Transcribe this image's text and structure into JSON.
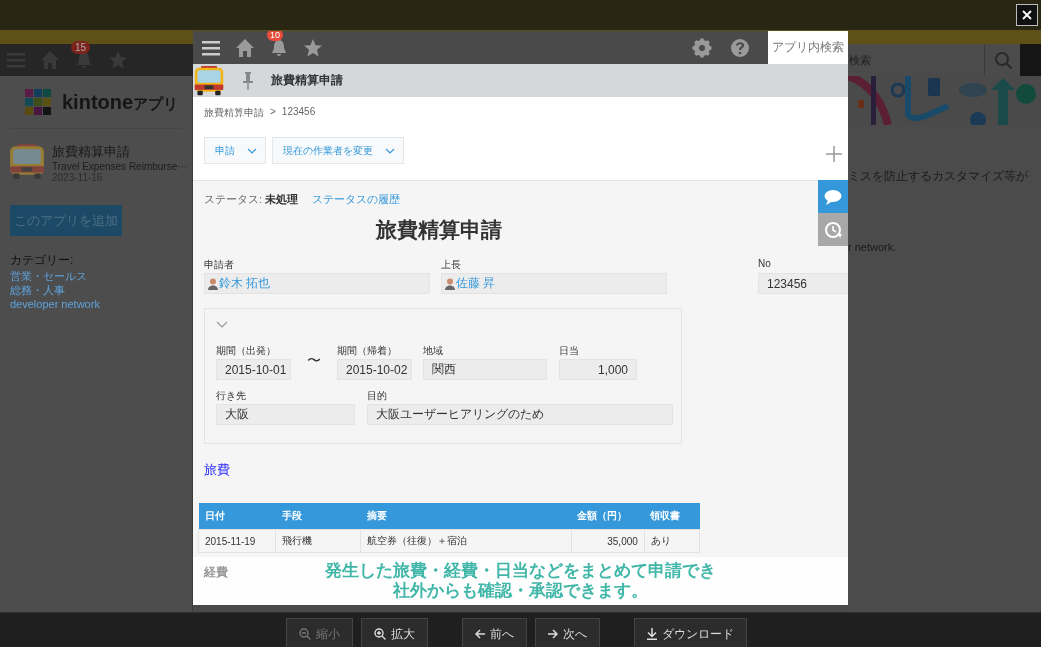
{
  "background_page": {
    "header": {
      "notification_count": "15",
      "search_placeholder": "検索"
    },
    "logo_text": "kintone",
    "logo_suffix": "アプリ",
    "app": {
      "name": "旅費精算申請",
      "subtitle": "Travel Expenses Reimburse···",
      "date": "2023-11-16"
    },
    "add_button": "このアプリを追加",
    "category_label": "カテゴリー:",
    "categories": [
      "営業・セールス",
      "総務・人事",
      "developer network"
    ],
    "description_lines": [
      "ミスを防止するカスタマイズ等が",
      "r network."
    ]
  },
  "record": {
    "header": {
      "notification_count": "10",
      "search_placeholder": "アプリ内検索"
    },
    "app_title": "旅費精算申請",
    "breadcrumb": {
      "app": "旅費精算申請",
      "separator": ">",
      "record": "123456"
    },
    "actions": [
      "申請",
      "現在の作業者を変更"
    ],
    "side_tabs": [
      {
        "kind": "comments",
        "selected": true
      },
      {
        "kind": "history",
        "selected": false
      }
    ],
    "status": {
      "label": "ステータス:",
      "value": "未処理",
      "history_link": "ステータスの履歴"
    },
    "form_title": "旅費精算申請",
    "fields": [
      {
        "label": "申請者",
        "value": "鈴木 拓也",
        "kind": "user"
      },
      {
        "label": "上長",
        "value": "佐藤 昇",
        "kind": "user"
      },
      {
        "label": "No",
        "value": "123456",
        "kind": "text"
      }
    ],
    "group": {
      "expanded": true,
      "period_fields": [
        {
          "label": "期間（出発）",
          "value": "2015-10-01",
          "kind": "text"
        },
        {
          "value": "〜",
          "kind": "separator"
        },
        {
          "label": "期間（帰着）",
          "value": "2015-10-02",
          "kind": "text"
        },
        {
          "label": "地域",
          "value": "関西",
          "kind": "text"
        },
        {
          "label": "日当",
          "value": "1,000",
          "kind": "number"
        }
      ],
      "trip_fields": [
        {
          "label": "行き先",
          "value": "大阪",
          "kind": "text"
        },
        {
          "label": "目的",
          "value": "大阪ユーザーヒアリングのため",
          "kind": "text"
        }
      ]
    },
    "section_title": "旅費",
    "table": {
      "columns": [
        "日付",
        "手段",
        "摘要",
        "金額（円）",
        "領収書"
      ],
      "rows": [
        [
          "2015-11-19",
          "飛行機",
          "航空券（往復）＋宿泊",
          "35,000",
          "あり"
        ]
      ]
    },
    "next_section_title": "経費"
  },
  "caption": [
    "発生した旅費・経費・日当などをまとめて申請でき",
    "社外からも確認・承認できます。"
  ],
  "toolbar": [
    {
      "kind": "zoom-out",
      "label": "縮小",
      "disabled": true
    },
    {
      "kind": "zoom-in",
      "label": "拡大",
      "disabled": false
    },
    {
      "kind": "previous",
      "label": "前へ",
      "disabled": false
    },
    {
      "kind": "next",
      "label": "次へ",
      "disabled": false
    },
    {
      "kind": "download",
      "label": "ダウンロード",
      "disabled": false
    }
  ]
}
